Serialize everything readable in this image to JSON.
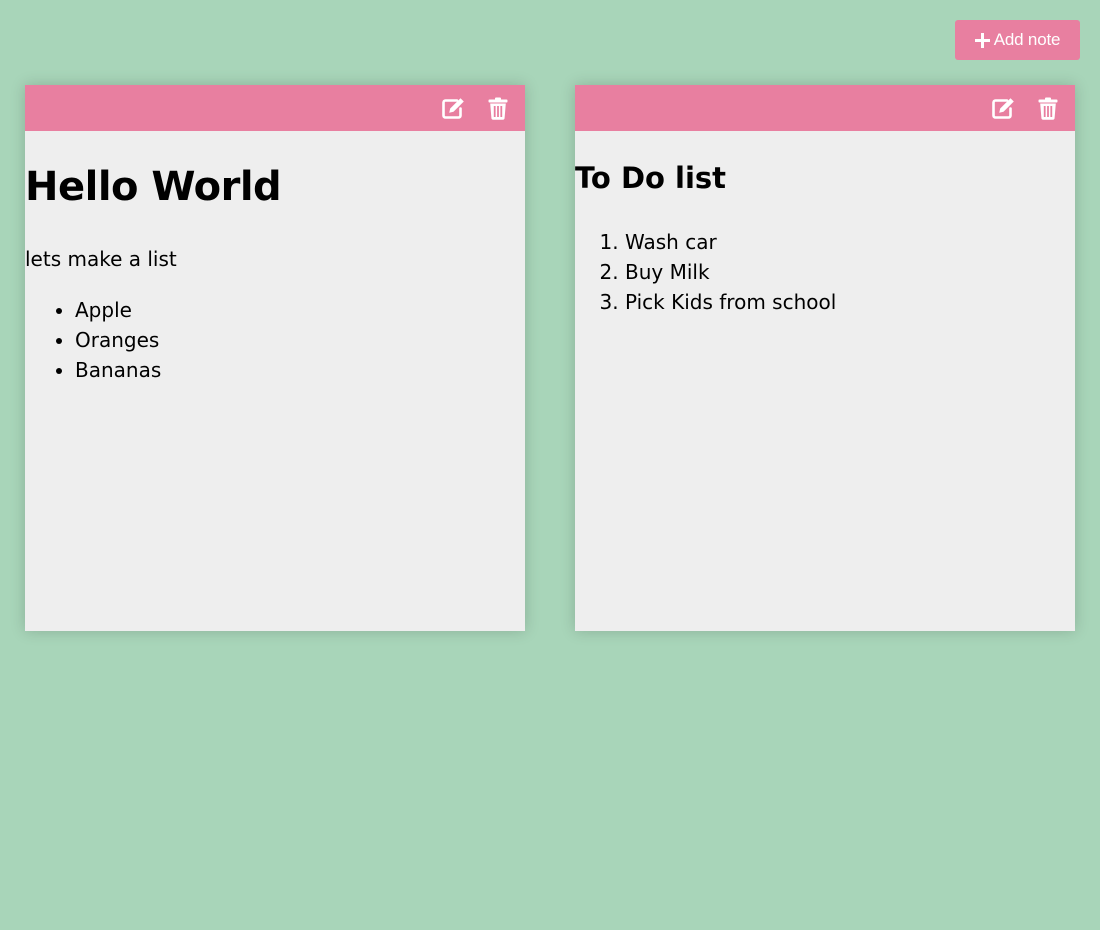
{
  "toolbar": {
    "add_note_label": "Add note",
    "add_icon": "plus-icon"
  },
  "colors": {
    "background": "#a8d5b9",
    "accent": "#e87fa0",
    "note_background": "#eeeeee",
    "icon": "#ffffff"
  },
  "notes": [
    {
      "title": "Hello World",
      "text": "lets make a list",
      "list_type": "bulleted",
      "items": [
        "Apple",
        "Oranges",
        "Bananas"
      ],
      "icons": [
        "edit-icon",
        "trash-icon"
      ]
    },
    {
      "title": "To Do list",
      "list_type": "numbered",
      "items": [
        "Wash car",
        "Buy Milk",
        "Pick Kids from school"
      ],
      "icons": [
        "edit-icon",
        "trash-icon"
      ]
    }
  ]
}
